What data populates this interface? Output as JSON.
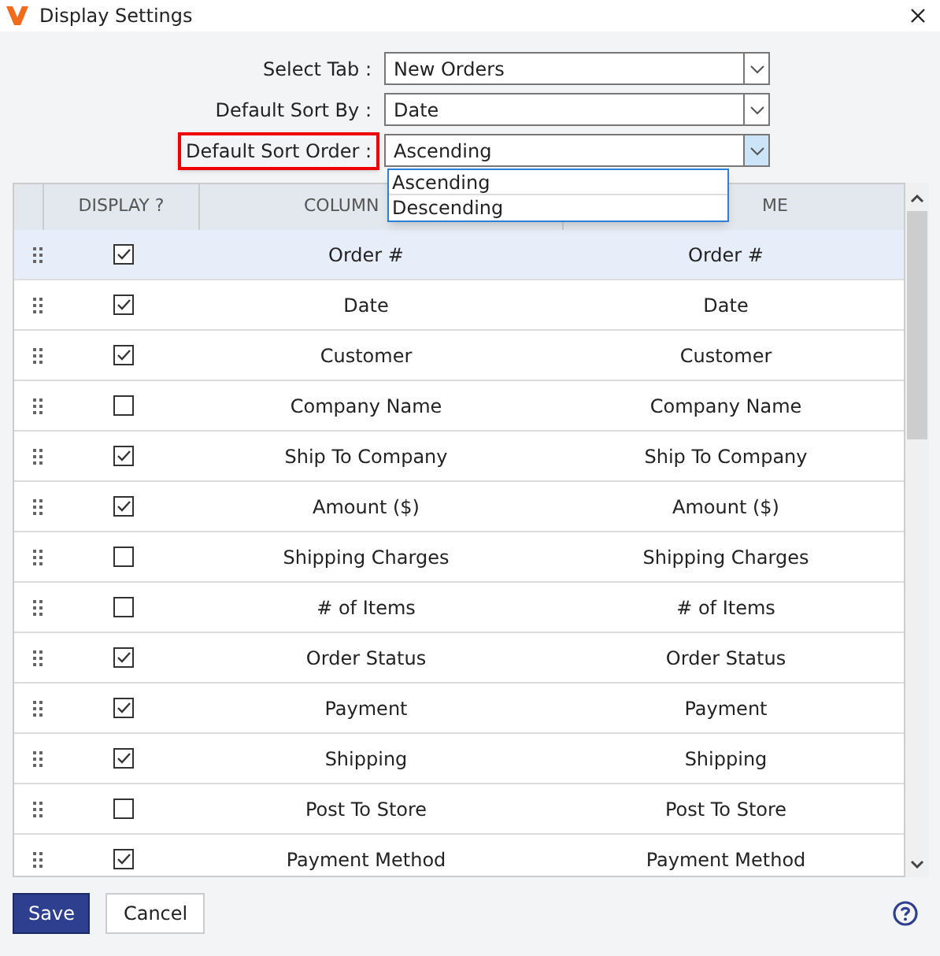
{
  "window": {
    "title": "Display Settings"
  },
  "form": [
    {
      "label": "Select Tab :",
      "value": "New Orders",
      "highlighted": false
    },
    {
      "label": "Default Sort By :",
      "value": "Date",
      "highlighted": false
    },
    {
      "label": "Default Sort Order :",
      "value": "Ascending",
      "highlighted": true,
      "open": true
    }
  ],
  "dropdown_options": [
    {
      "label": "Ascending",
      "selected": false
    },
    {
      "label": "Descending",
      "selected": false
    }
  ],
  "table": {
    "columns": [
      "DISPLAY ?",
      "COLUMN",
      "ME"
    ],
    "rows": [
      {
        "checked": true,
        "column": "Order #",
        "display_name": "Order #",
        "selected": true
      },
      {
        "checked": true,
        "column": "Date",
        "display_name": "Date",
        "selected": false
      },
      {
        "checked": true,
        "column": "Customer",
        "display_name": "Customer",
        "selected": false
      },
      {
        "checked": false,
        "column": "Company Name",
        "display_name": "Company Name",
        "selected": false
      },
      {
        "checked": true,
        "column": "Ship To Company",
        "display_name": "Ship To Company",
        "selected": false
      },
      {
        "checked": true,
        "column": "Amount ($)",
        "display_name": "Amount ($)",
        "selected": false
      },
      {
        "checked": false,
        "column": "Shipping Charges",
        "display_name": "Shipping Charges",
        "selected": false
      },
      {
        "checked": false,
        "column": "# of Items",
        "display_name": "# of Items",
        "selected": false
      },
      {
        "checked": true,
        "column": "Order Status",
        "display_name": "Order Status",
        "selected": false
      },
      {
        "checked": true,
        "column": "Payment",
        "display_name": "Payment",
        "selected": false
      },
      {
        "checked": true,
        "column": "Shipping",
        "display_name": "Shipping",
        "selected": false
      },
      {
        "checked": false,
        "column": "Post To Store",
        "display_name": "Post To Store",
        "selected": false
      },
      {
        "checked": true,
        "column": "Payment Method",
        "display_name": "Payment Method",
        "selected": false
      }
    ]
  },
  "buttons": [
    {
      "label": "Save",
      "kind": "primary"
    },
    {
      "label": "Cancel",
      "kind": "secondary"
    }
  ]
}
